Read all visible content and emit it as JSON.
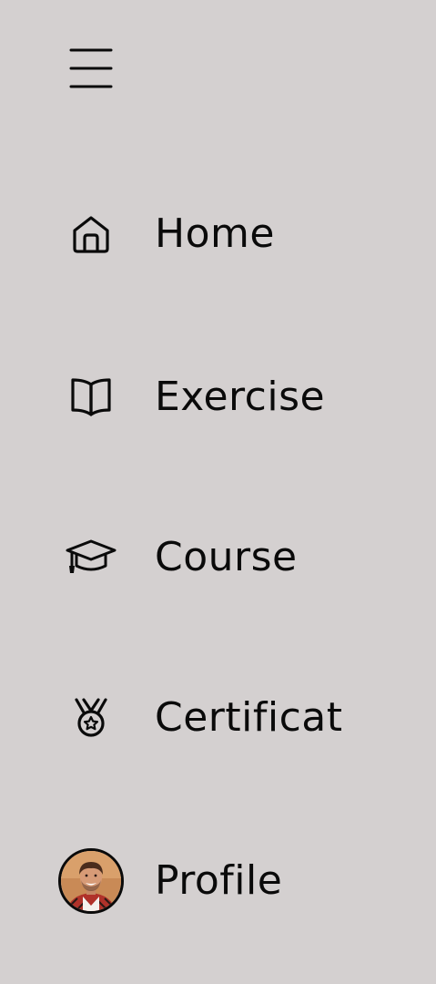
{
  "menu": {
    "icon": "hamburger-menu-icon"
  },
  "nav": {
    "items": [
      {
        "label": "Home",
        "icon": "home-icon"
      },
      {
        "label": "Exercise",
        "icon": "book-icon"
      },
      {
        "label": "Course",
        "icon": "graduation-cap-icon"
      },
      {
        "label": "Certificat",
        "icon": "medal-icon"
      },
      {
        "label": "Profile",
        "icon": "avatar"
      }
    ]
  },
  "colors": {
    "background": "#d4d0d0",
    "foreground": "#0a0a0a"
  }
}
